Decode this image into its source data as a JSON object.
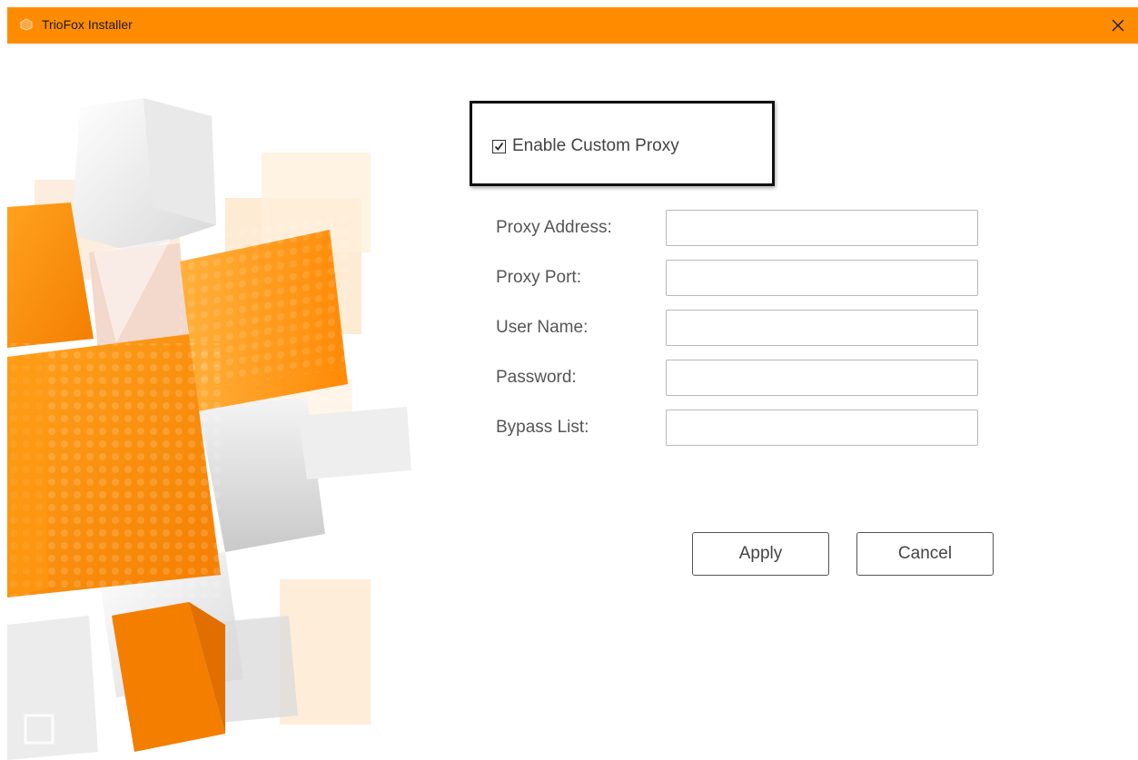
{
  "window": {
    "title": "TrioFox Installer",
    "accent_color": "#ff8c00"
  },
  "titlebar": {
    "app_icon": "triofox-logo-icon",
    "close_icon": "close-icon",
    "close_glyph": "✕"
  },
  "proxy": {
    "enable_label": "Enable Custom Proxy",
    "enabled": true,
    "fields": [
      {
        "label": "Proxy Address:",
        "value": ""
      },
      {
        "label": "Proxy Port:",
        "value": ""
      },
      {
        "label": "User Name:",
        "value": ""
      },
      {
        "label": "Password:",
        "value": ""
      },
      {
        "label": "Bypass List:",
        "value": ""
      }
    ]
  },
  "buttons": {
    "apply": "Apply",
    "cancel": "Cancel"
  },
  "decoration": {
    "art": "orange-white-cubes-illustration"
  }
}
